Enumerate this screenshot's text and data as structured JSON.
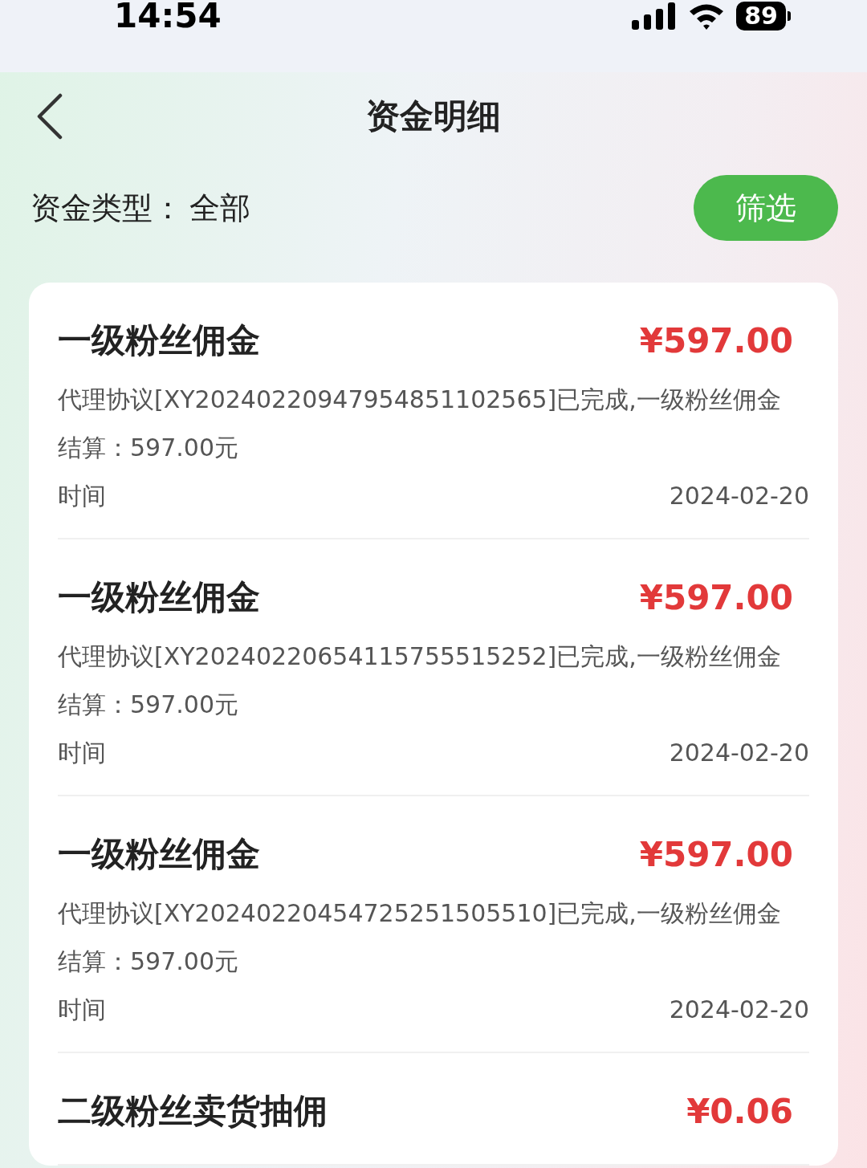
{
  "status_bar": {
    "time": "14:54",
    "battery": "89"
  },
  "header": {
    "title": "资金明细"
  },
  "filter": {
    "label": "资金类型：",
    "value": "全部",
    "button": "筛选"
  },
  "records": [
    {
      "title": "一级粉丝佣金",
      "amount": "¥597.00",
      "description": "代理协议[XY20240220947954851102565]已完成,一级粉丝佣金",
      "settlement": "结算：597.00元",
      "time_label": "时间",
      "date": "2024-02-20"
    },
    {
      "title": "一级粉丝佣金",
      "amount": "¥597.00",
      "description": "代理协议[XY20240220654115755515252]已完成,一级粉丝佣金",
      "settlement": "结算：597.00元",
      "time_label": "时间",
      "date": "2024-02-20"
    },
    {
      "title": "一级粉丝佣金",
      "amount": "¥597.00",
      "description": "代理协议[XY20240220454725251505510]已完成,一级粉丝佣金",
      "settlement": "结算：597.00元",
      "time_label": "时间",
      "date": "2024-02-20"
    },
    {
      "title": "二级粉丝卖货抽佣",
      "amount": "¥0.06"
    }
  ]
}
